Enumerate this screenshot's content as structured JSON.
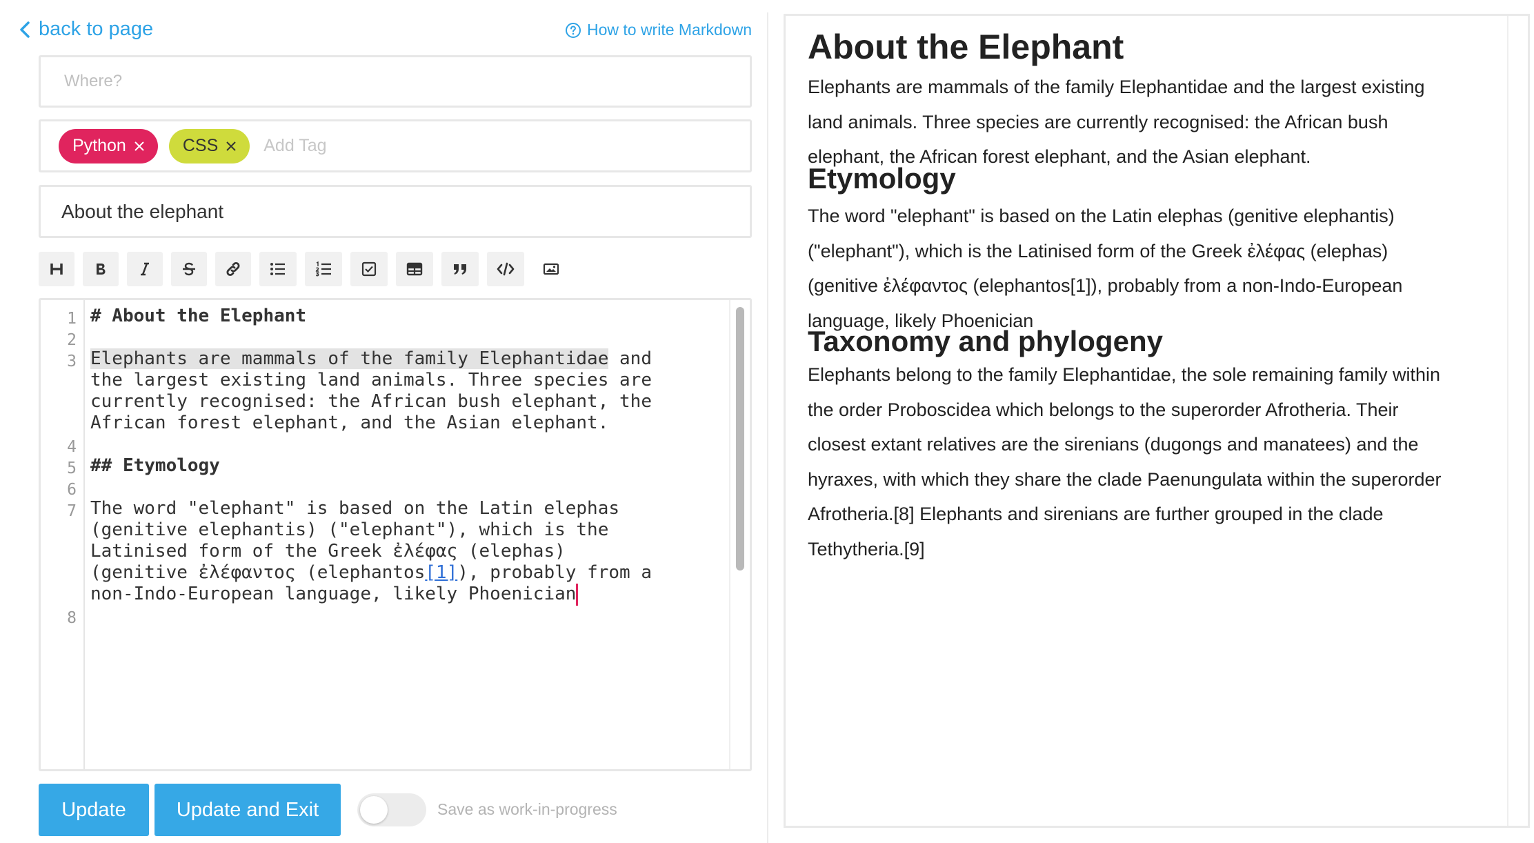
{
  "header": {
    "back_label": "back to page",
    "help_label": "How to write Markdown"
  },
  "form": {
    "where_placeholder": "Where?",
    "tags": [
      "Python",
      "CSS"
    ],
    "add_tag_placeholder": "Add Tag",
    "title_value": "About the elephant"
  },
  "toolbar": {
    "buttons": [
      "heading",
      "bold",
      "italic",
      "strikethrough",
      "link",
      "bulleted-list",
      "numbered-list",
      "checklist",
      "table",
      "quote",
      "code",
      "image"
    ]
  },
  "editor": {
    "line_numbers": [
      "1",
      "2",
      "3",
      "4",
      "5",
      "6",
      "7",
      "8"
    ],
    "lines": {
      "l1": "# About the Elephant",
      "l3a_highlight": "Elephants are mammals of the family Elephantidae",
      "l3a_rest": " and",
      "l3b": "the largest existing land animals. Three species are",
      "l3c": "currently recognised: the African bush elephant, the",
      "l3d": "African forest elephant, and the Asian elephant.",
      "l5": "## Etymology",
      "l7a": "The word \"elephant\" is based on the Latin elephas",
      "l7b": "(genitive elephantis) (\"elephant\"), which is the",
      "l7c": "Latinised form of the Greek ἐλέφας (elephas)",
      "l7d_pre": "(genitive ἐλέφαντος (elephantos",
      "l7d_ref": "[1]",
      "l7d_post": "), probably from a",
      "l7e": "non-Indo-European language, likely Phoenician"
    }
  },
  "actions": {
    "update_label": "Update",
    "update_exit_label": "Update and Exit",
    "wip_label": "Save as work-in-progress",
    "wip_enabled": false
  },
  "preview": {
    "h1": "About the Elephant",
    "p1": [
      "Elephants are mammals of the family Elephantidae and the largest existing",
      "land animals. Three species are currently recognised: the African bush",
      "elephant, the African forest elephant, and the Asian elephant."
    ],
    "h2_etymology": "Etymology",
    "p2": [
      "The word \"elephant\" is based on the Latin elephas (genitive elephantis)",
      "(\"elephant\"), which is the Latinised form of the Greek ἐλέφας (elephas)",
      "(genitive ἐλέφαντος (elephantos[1]), probably from a non-Indo-European",
      "language, likely Phoenician"
    ],
    "h2_taxonomy": "Taxonomy and phylogeny",
    "p3": [
      "Elephants belong to the family Elephantidae, the sole remaining family within",
      "the order Proboscidea which belongs to the superorder Afrotheria. Their",
      "closest extant relatives are the sirenians (dugongs and manatees) and the",
      "hyraxes, with which they share the clade Paenungulata within the superorder",
      "Afrotheria.[8] Elephants and sirenians are further grouped in the clade",
      "Tethytheria.[9]"
    ]
  },
  "colors": {
    "accent": "#36a8e6",
    "link": "#2ea3e6",
    "tag_python": "#e0245e",
    "tag_css": "#cfdb3c",
    "cursor": "#e0245e"
  }
}
